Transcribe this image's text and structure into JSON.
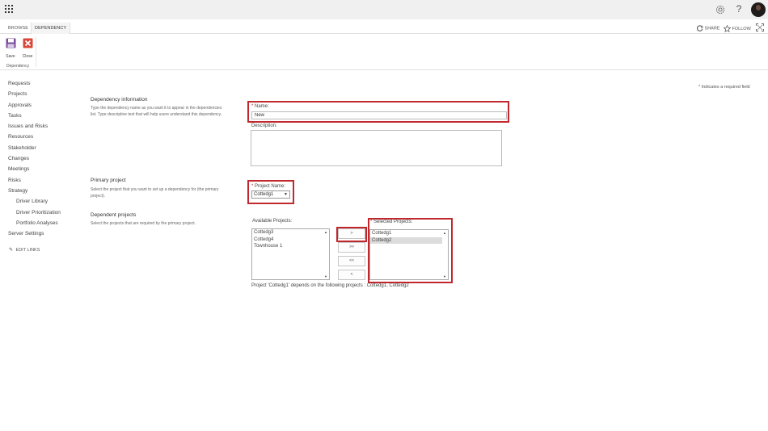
{
  "suite_bar": {
    "app_launcher_icon": "waffle-grid-icon",
    "settings_icon": "gear-icon",
    "help_label": "?",
    "avatar_icon": "user-avatar"
  },
  "ribbon": {
    "tabs": [
      {
        "label": "BROWSE",
        "active": false
      },
      {
        "label": "DEPENDENCY",
        "active": true
      }
    ],
    "share_label": "SHARE",
    "follow_label": "FOLLOW",
    "save_label": "Save",
    "close_label": "Close",
    "group_label": "Dependency"
  },
  "nav": {
    "items": [
      "Requests",
      "Projects",
      "Approvals",
      "Tasks",
      "Issues and Risks",
      "Resources",
      "Stakeholder",
      "Changes",
      "Meetings",
      "Risks",
      "Strategy"
    ],
    "sub_items": [
      "Driver Library",
      "Driver Prioritization",
      "Portfolio Analyses"
    ],
    "footer_item": "Server Settings",
    "edit_links": "EDIT LINKS"
  },
  "required_note": "* Indicates a required field",
  "sections": {
    "dependency_info": {
      "title": "Dependency information",
      "desc": "Type the dependency name as you want it to appear in the dependencies list. Type descriptive text that will help users understand this dependency."
    },
    "primary_project": {
      "title": "Primary project",
      "desc": "Select the project that you want to set up a dependency for (the primary project)."
    },
    "dependent_projects": {
      "title": "Dependent projects",
      "desc": "Select the projects that are required by the primary project."
    }
  },
  "form": {
    "required_mark": "*",
    "name_label": "Name:",
    "name_value": "New",
    "description_label": "Description:",
    "description_value": "",
    "project_name_label": "Project Name:",
    "project_name_value": "Cottedg1",
    "available_label": "Available Projects:",
    "available_projects": [
      "Cottedg3",
      "Cottedg4",
      "Townhouse 1"
    ],
    "selected_label": "Selected Projects:",
    "selected_projects": [
      "Cottedg1",
      "Cottedg2"
    ],
    "selected_highlight_index": 1,
    "move_buttons": [
      ">",
      ">>",
      "<<",
      "<"
    ],
    "dependency_summary": "Project 'Cottedg1' depends on the following projects : Cottedg1, Cottedg2"
  },
  "colors": {
    "highlight_border": "#c0282d",
    "suite_bar_bg": "#f0f0f0",
    "save_icon": "#7a4c9c",
    "close_icon": "#d9473a"
  }
}
